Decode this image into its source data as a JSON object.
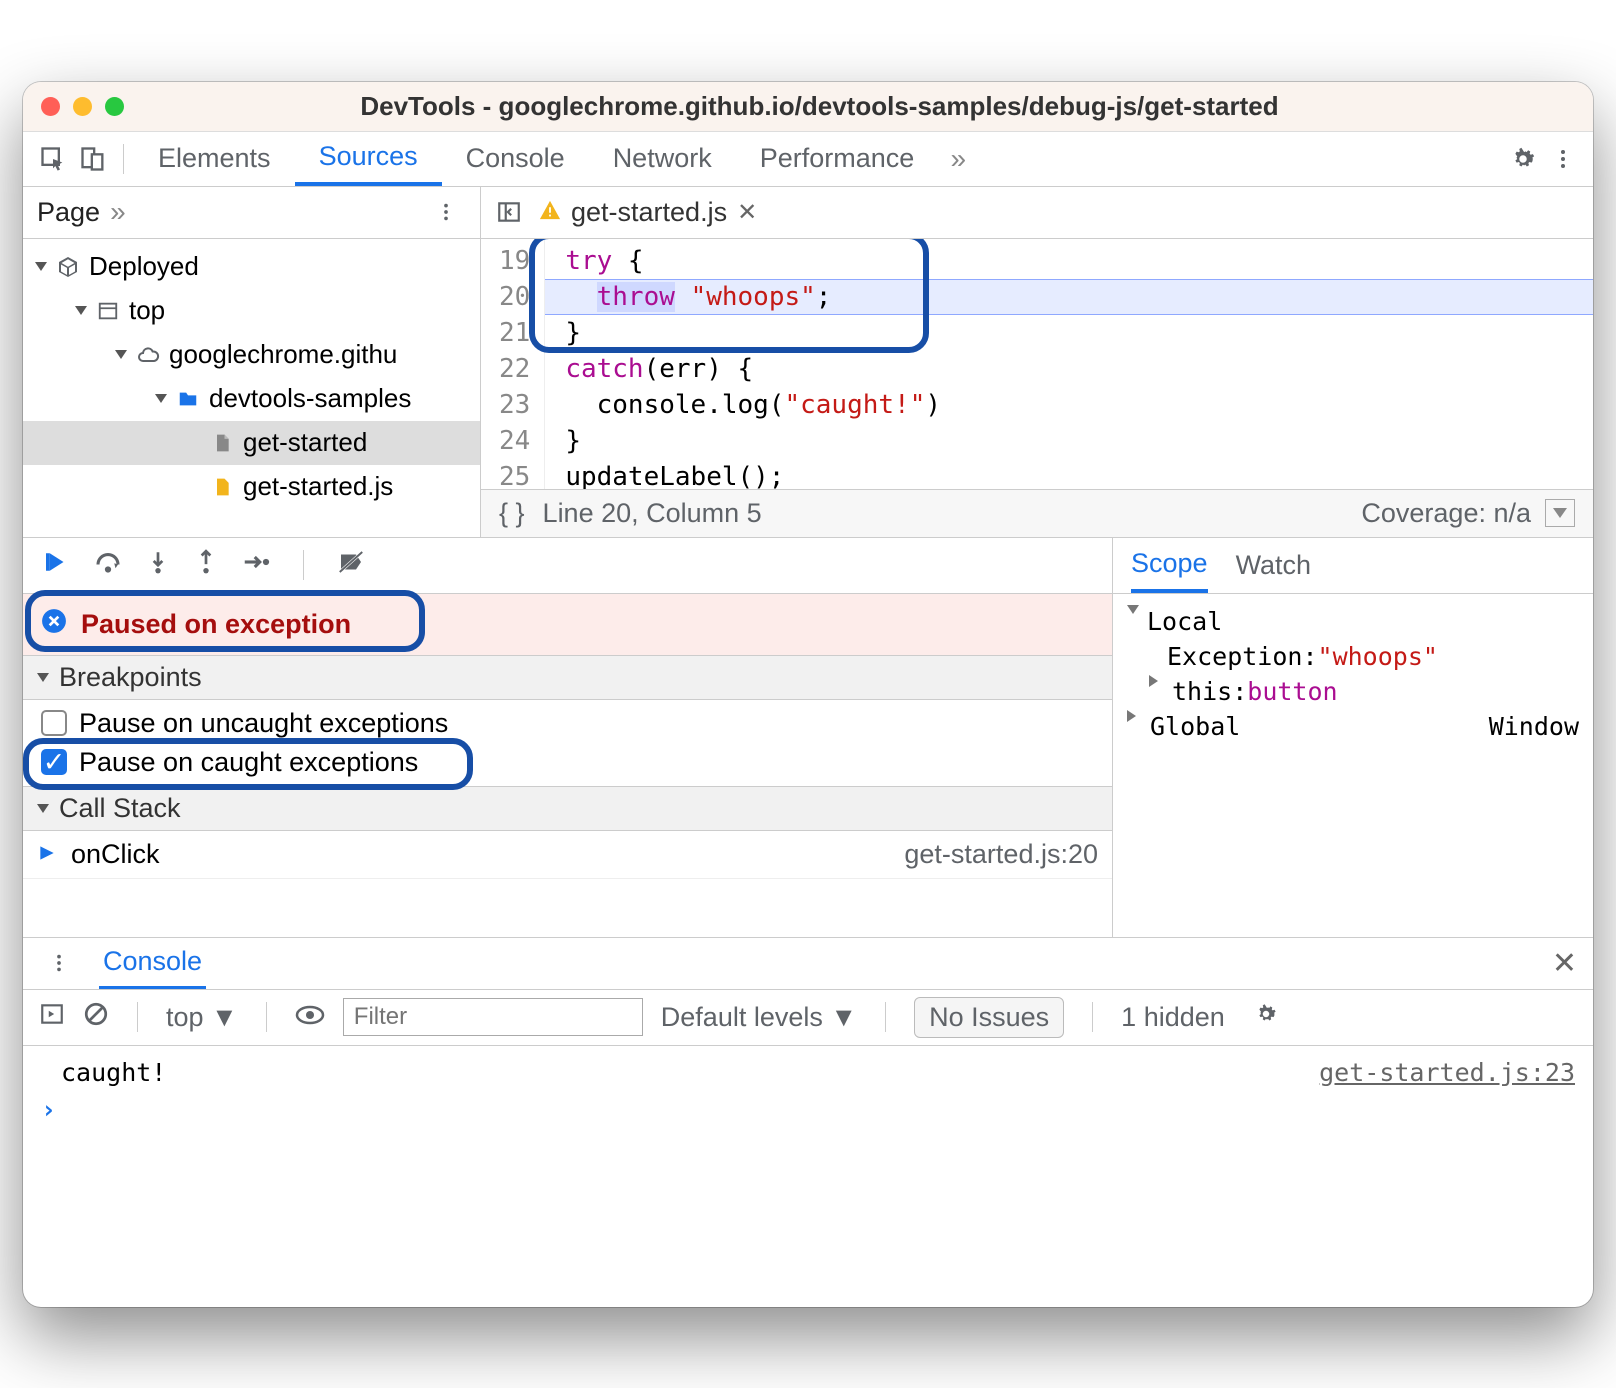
{
  "title": "DevTools - googlechrome.github.io/devtools-samples/debug-js/get-started",
  "top_tabs": [
    "Elements",
    "Sources",
    "Console",
    "Network",
    "Performance"
  ],
  "top_tab_active": "Sources",
  "sidebar": {
    "page_label": "Page"
  },
  "file_tree": {
    "root": "Deployed",
    "n1": "top",
    "n2": "googlechrome.githu",
    "n3": "devtools-samples",
    "n4": "get-started",
    "n5": "get-started.js"
  },
  "file_tab": {
    "name": "get-started.js"
  },
  "code": {
    "lines": [
      19,
      20,
      21,
      22,
      23,
      24,
      25
    ],
    "l19a": "try",
    "l19b": " {",
    "l20a": "throw",
    "l20b": " ",
    "l20c": "\"whoops\"",
    "l20d": ";",
    "l21": "}",
    "l22a": "catch",
    "l22b": "(err) {",
    "l23a": "  console.log(",
    "l23b": "\"caught!\"",
    "l23c": ")",
    "l24": "}",
    "l25": "updateLabel();"
  },
  "status": {
    "pos": "Line 20, Column 5",
    "coverage": "Coverage: n/a"
  },
  "pause_message": "Paused on exception",
  "breakpoints": {
    "header": "Breakpoints",
    "uncaught": "Pause on uncaught exceptions",
    "caught": "Pause on caught exceptions"
  },
  "callstack": {
    "header": "Call Stack",
    "frame": "onClick",
    "frame_src": "get-started.js:20"
  },
  "scope": {
    "tab_scope": "Scope",
    "tab_watch": "Watch",
    "local": "Local",
    "exc_key": "Exception: ",
    "exc_val": "\"whoops\"",
    "this_key": "this: ",
    "this_val": "button",
    "global": "Global",
    "global_val": "Window"
  },
  "console": {
    "label": "Console",
    "context": "top",
    "filter_ph": "Filter",
    "levels": "Default levels",
    "issues": "No Issues",
    "hidden": "1 hidden",
    "msg": "caught!",
    "msg_src": "get-started.js:23"
  },
  "colors": {
    "blue": "#1a73e8",
    "highlight": "#174ea6",
    "red_text": "#a50e0e"
  }
}
